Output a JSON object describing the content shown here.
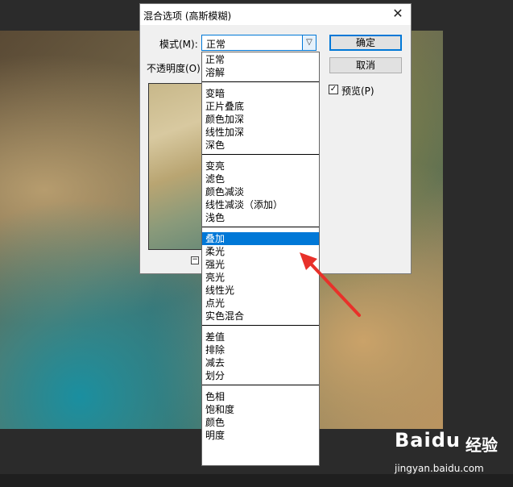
{
  "dialog": {
    "title": "混合选项 (高斯模糊)",
    "close_glyph": "✕",
    "mode_label": "模式(M):",
    "mode_value": "正常",
    "dropdown_arrow": "▽",
    "ok_label": "确定",
    "cancel_label": "取消",
    "opacity_label": "不透明度(O)",
    "preview_label": "预览(P)",
    "preview_checked": true,
    "checkmark": "✓",
    "zoom_minus": "−"
  },
  "blend_modes": {
    "groups": [
      [
        "正常",
        "溶解"
      ],
      [
        "变暗",
        "正片叠底",
        "颜色加深",
        "线性加深",
        "深色"
      ],
      [
        "变亮",
        "滤色",
        "颜色减淡",
        "线性减淡（添加）",
        "浅色"
      ],
      [
        "叠加",
        "柔光",
        "强光",
        "亮光",
        "线性光",
        "点光",
        "实色混合"
      ],
      [
        "差值",
        "排除",
        "减去",
        "划分"
      ],
      [
        "色相",
        "饱和度",
        "颜色",
        "明度"
      ]
    ],
    "selected": "叠加"
  },
  "colors": {
    "accent": "#0078d7",
    "annotation_arrow": "#e8312a"
  },
  "watermark": {
    "logo": "Baidu",
    "brand_cn": "经验",
    "url": "jingyan.baidu.com"
  }
}
